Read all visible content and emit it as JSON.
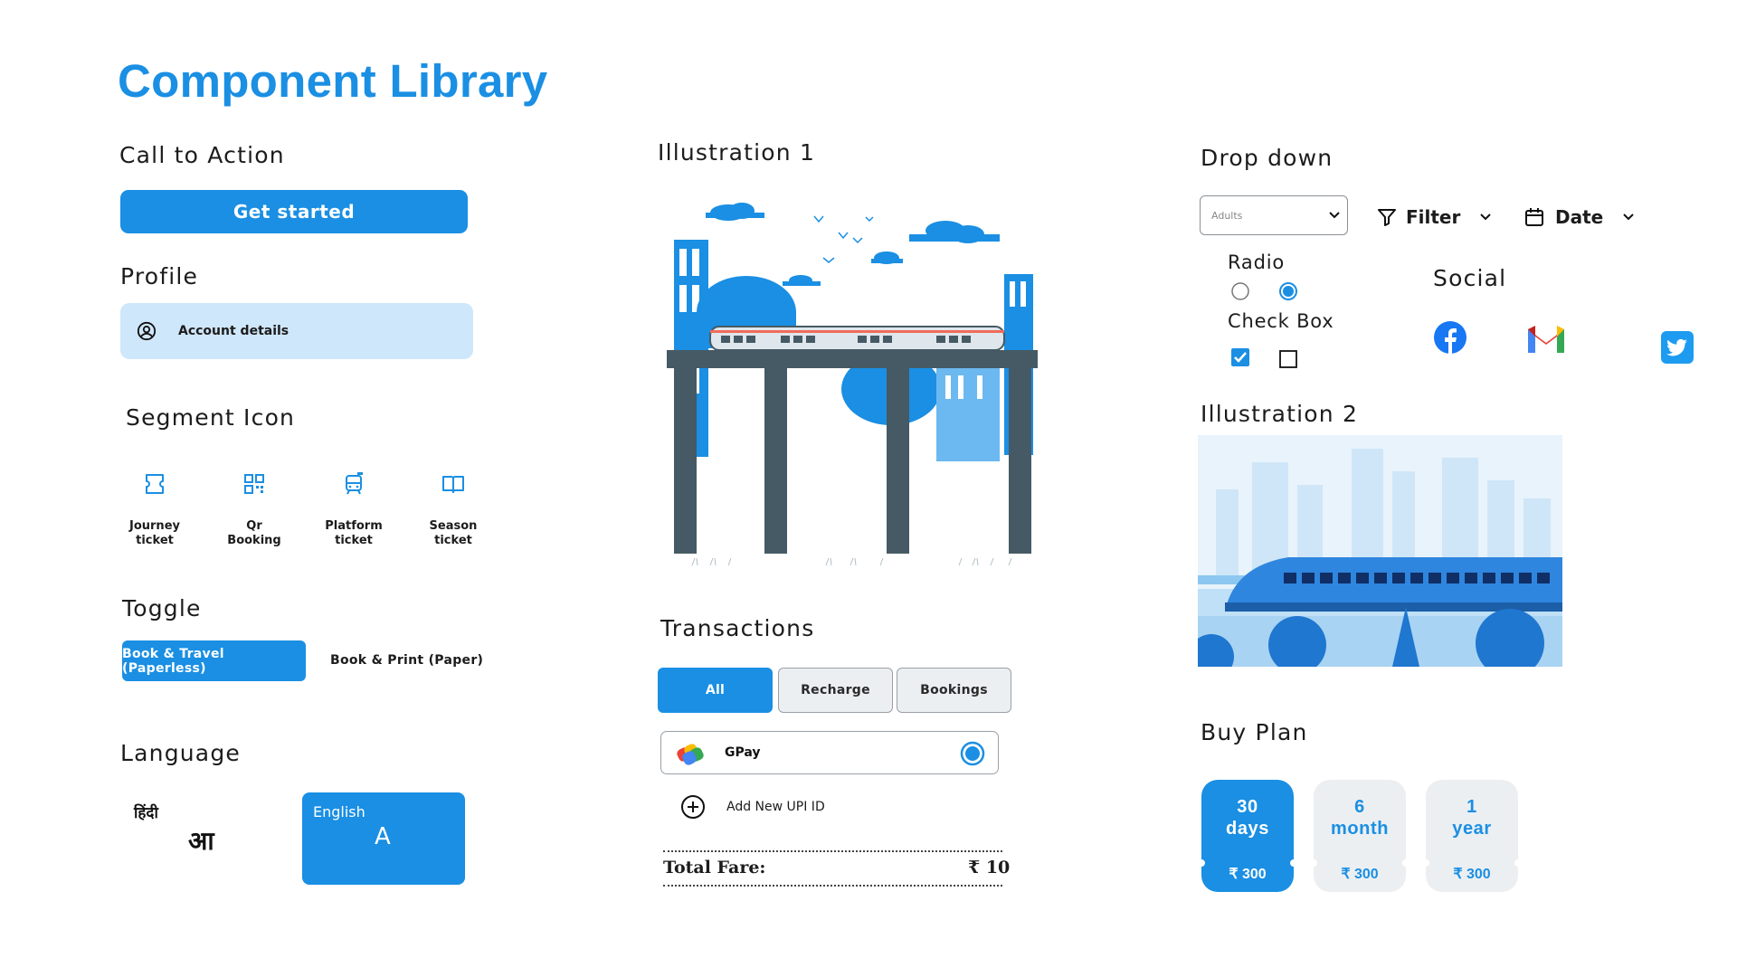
{
  "title": "Component Library",
  "sections": {
    "cta": "Call to Action",
    "profile": "Profile",
    "segment": "Segment Icon",
    "toggle": "Toggle",
    "language": "Language",
    "illustration1": "Illustration 1",
    "transactions": "Transactions",
    "dropdown": "Drop down",
    "radio": "Radio",
    "checkbox": "Check Box",
    "social": "Social",
    "illustration2": "Illustration 2",
    "buyplan": "Buy Plan"
  },
  "cta": {
    "label": "Get started"
  },
  "profile": {
    "label": "Account details"
  },
  "segments": [
    {
      "label": "Journey ticket",
      "icon": "ticket-icon"
    },
    {
      "label": "Qr Booking",
      "icon": "qr-code-icon"
    },
    {
      "label": "Platform ticket",
      "icon": "train-icon"
    },
    {
      "label": "Season ticket",
      "icon": "book-icon"
    }
  ],
  "toggle": {
    "on": "Book & Travel (Paperless)",
    "off": "Book & Print (Paper)"
  },
  "language": {
    "hindi_label": "हिंदी",
    "hindi_glyph": "आ",
    "english_label": "English",
    "english_glyph": "A"
  },
  "transactions": {
    "tabs": [
      "All",
      "Recharge",
      "Bookings"
    ],
    "payment": "GPay",
    "add_upi": "Add New UPI ID",
    "total_label": "Total Fare:",
    "total_value": "₹ 10"
  },
  "dropdown": {
    "select_value": "Adults",
    "filter": "Filter",
    "date": "Date"
  },
  "social": [
    "facebook-icon",
    "gmail-icon",
    "twitter-icon"
  ],
  "plans": [
    {
      "line1": "30",
      "line2": "days",
      "price": "₹ 300",
      "selected": true
    },
    {
      "line1": "6",
      "line2": "month",
      "price": "₹ 300",
      "selected": false
    },
    {
      "line1": "1",
      "line2": "year",
      "price": "₹ 300",
      "selected": false
    }
  ],
  "colors": {
    "primary": "#1a8fe3",
    "light": "#cfe7fb",
    "inactive": "#eceff2"
  }
}
